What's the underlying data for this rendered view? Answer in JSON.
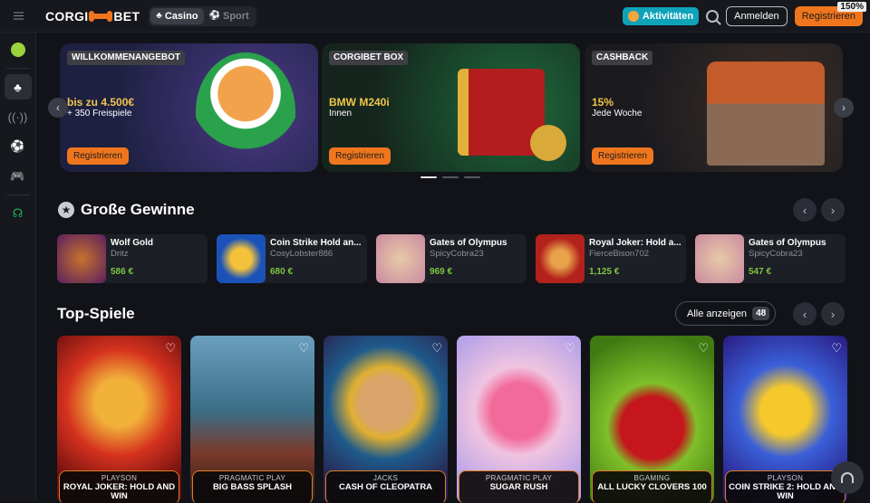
{
  "brand": {
    "name_left": "CORGI",
    "name_right": "BET",
    "accent": "#f0761e"
  },
  "topbar": {
    "tabs": [
      {
        "label": "Casino",
        "icon": "casino-icon",
        "active": true
      },
      {
        "label": "Sport",
        "icon": "soccer-ball-icon",
        "active": false
      }
    ],
    "activities_label": "Aktivitäten",
    "login_label": "Anmelden",
    "register_label": "Registrieren",
    "zoom_badge": "150%"
  },
  "banners": [
    {
      "tag": "WILLKOMMENANGEBOT",
      "headline": "bis zu 4.500€",
      "sub": "+ 350 Freispiele",
      "button": "Registrieren"
    },
    {
      "tag": "CORGIBET BOX",
      "headline": "BMW M240i",
      "sub": "Innen",
      "button": "Registrieren"
    },
    {
      "tag": "CASHBACK",
      "headline": "15%",
      "sub": "Jede Woche",
      "button": "Registrieren"
    }
  ],
  "banner_active_index": 0,
  "big_wins": {
    "title": "Große Gewinne",
    "items": [
      {
        "game": "Wolf Gold",
        "user": "Dritz",
        "amount": "586 €"
      },
      {
        "game": "Coin Strike Hold an...",
        "user": "CosyLobster886",
        "amount": "680 €"
      },
      {
        "game": "Gates of Olympus",
        "user": "SpicyCobra23",
        "amount": "969 €"
      },
      {
        "game": "Royal Joker: Hold a...",
        "user": "FierceBison702",
        "amount": "1,125 €"
      },
      {
        "game": "Gates of Olympus",
        "user": "SpicyCobra23",
        "amount": "547 €"
      }
    ]
  },
  "top_games": {
    "title": "Top-Spiele",
    "show_all_label": "Alle anzeigen",
    "show_all_count": "48",
    "items": [
      {
        "provider": "PLAYSON",
        "title": "ROYAL JOKER: HOLD AND WIN"
      },
      {
        "provider": "PRAGMATIC PLAY",
        "title": "BIG BASS SPLASH"
      },
      {
        "provider": "JACKS",
        "title": "CASH OF CLEOPATRA"
      },
      {
        "provider": "PRAGMATIC PLAY",
        "title": "SUGAR RUSH"
      },
      {
        "provider": "BGAMING",
        "title": "ALL LUCKY CLOVERS 100"
      },
      {
        "provider": "PLAYSON",
        "title": "COIN STRIKE 2: HOLD AND WIN"
      }
    ]
  }
}
